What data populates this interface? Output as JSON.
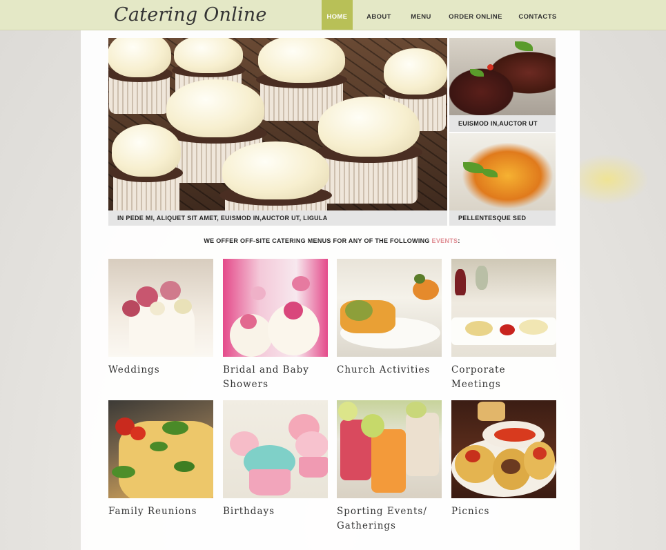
{
  "brand": {
    "logo_text": "Catering Online"
  },
  "nav": {
    "items": [
      {
        "label": "HOME",
        "active": true
      },
      {
        "label": "ABOUT",
        "active": false
      },
      {
        "label": "MENU",
        "active": false
      },
      {
        "label": "ORDER ONLINE",
        "active": false
      },
      {
        "label": "CONTACTS",
        "active": false
      }
    ]
  },
  "slider": {
    "main_caption": "IN PEDE MI, ALIQUET SIT AMET, EUISMOD IN,AUCTOR UT, LIGULA",
    "thumbs": [
      {
        "caption": "EUISMOD IN,AUCTOR UT"
      },
      {
        "caption": "PELLENTESQUE SED"
      }
    ]
  },
  "offer": {
    "text_before": "WE OFFER OFF-SITE CATERING MENUS FOR ANY OF THE FOLLOWING ",
    "highlight": "EVENTS",
    "text_after": ":"
  },
  "events": [
    {
      "label": "Weddings"
    },
    {
      "label": "Bridal and Baby Showers"
    },
    {
      "label": "Church Activities"
    },
    {
      "label": "Corporate Meetings"
    },
    {
      "label": "Family Reunions"
    },
    {
      "label": "Birthdays"
    },
    {
      "label": "Sporting Events/ Gatherings"
    },
    {
      "label": "Picnics"
    }
  ],
  "colors": {
    "topbar": "#e4e8c6",
    "nav_active": "#b8c057",
    "highlight": "#e08f95",
    "caption_bg": "#e5e5e5"
  }
}
